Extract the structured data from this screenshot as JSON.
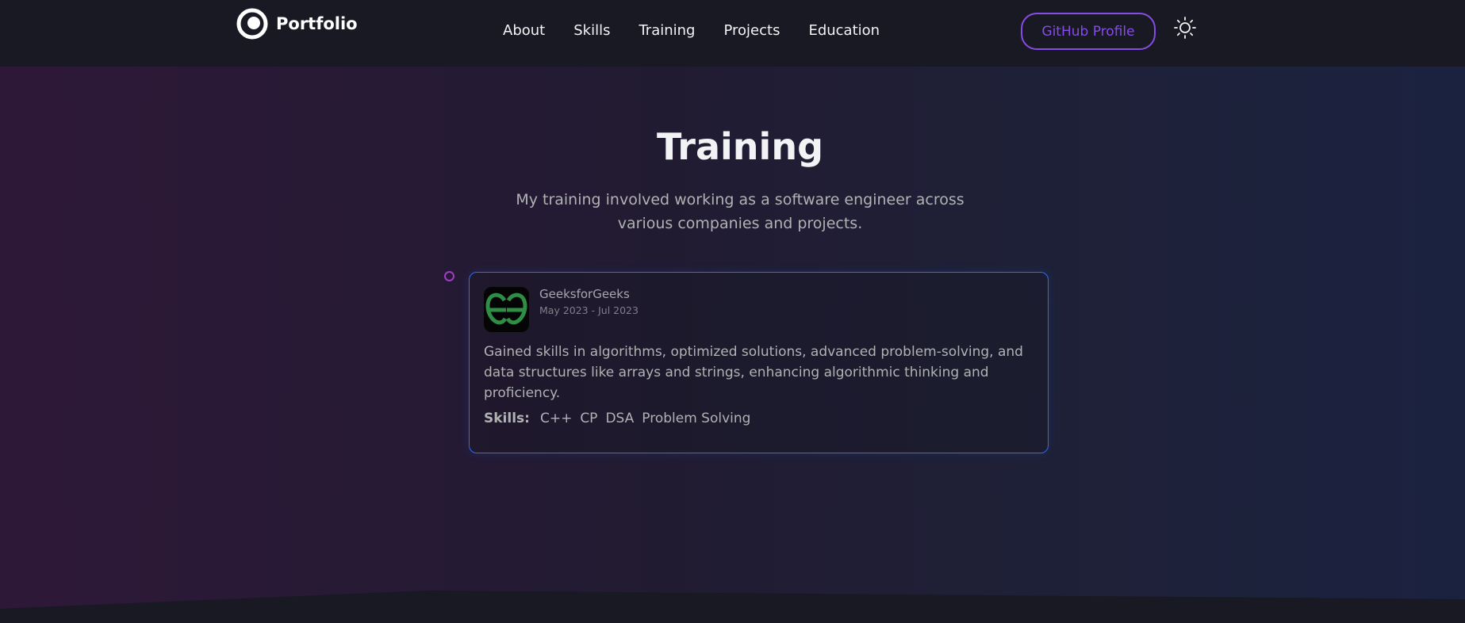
{
  "nav": {
    "logo_text": "Portfolio",
    "links": [
      "About",
      "Skills",
      "Training",
      "Projects",
      "Education"
    ],
    "github_label": "GitHub Profile",
    "theme_icon": "sun-icon"
  },
  "section": {
    "title": "Training",
    "description": "My training involved working as a software engineer across various companies and projects."
  },
  "training": {
    "company": "GeeksforGeeks",
    "date": "May 2023 - Jul 2023",
    "description": "Gained skills in algorithms, optimized solutions, advanced problem-solving, and data structures like arrays and strings, enhancing algorithmic thinking and proficiency.",
    "skills_label": "Skills:",
    "skills": [
      "C++",
      "CP",
      "DSA",
      "Problem Solving"
    ],
    "logo_icon": "geeksforgeeks-logo"
  },
  "colors": {
    "accent": "#854ce6",
    "card_border": "#306ee8",
    "timeline_dot": "#a23bc9",
    "logo_green": "#2f8d46"
  }
}
